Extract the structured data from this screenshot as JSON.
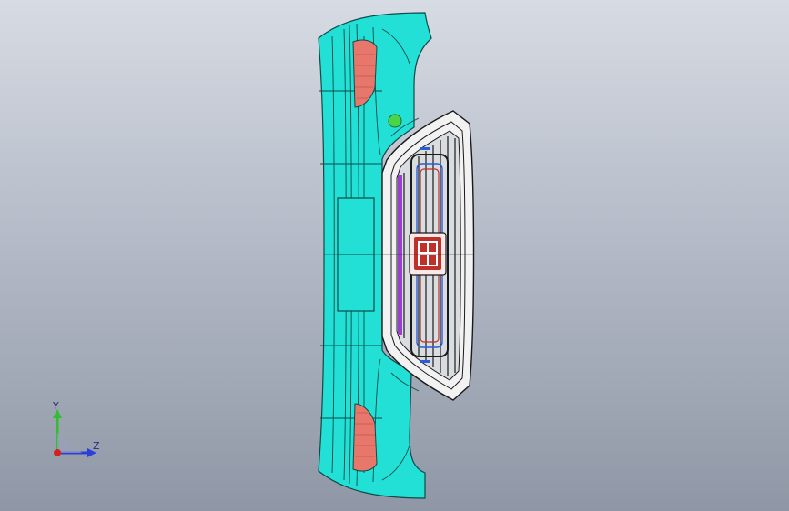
{
  "viewport": {
    "background_top": "#d7dbe3",
    "background_bottom": "#8f97a6"
  },
  "model": {
    "bumper_color": "#22e0d6",
    "bumper_edge_color": "#0e4a48",
    "lamp_color": "#e8776b",
    "grille_frame_color": "#f2f2f2",
    "grille_inner_color": "#1a1a1a",
    "accent_purple": "#9b3fd1",
    "accent_blue": "#2d5bd8",
    "accent_red": "#c0302a",
    "marker_color": "#4ad44a"
  },
  "triad": {
    "y_label": "Y",
    "z_label": "Z",
    "y_color": "#2fbf2f",
    "z_color": "#2c3fd8",
    "origin_color": "#d81f1f"
  }
}
